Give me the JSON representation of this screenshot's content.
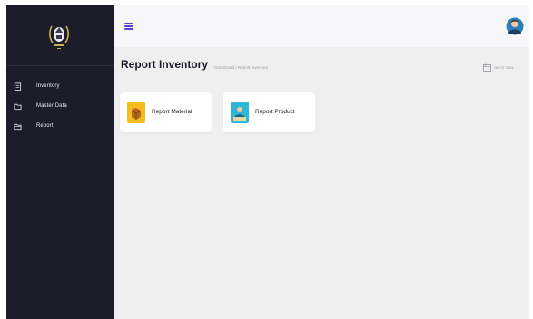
{
  "sidebar": {
    "items": [
      {
        "label": "Inventory",
        "icon": "clipboard-icon"
      },
      {
        "label": "Master Data",
        "icon": "folder-icon"
      },
      {
        "label": "Report",
        "icon": "document-icon"
      }
    ]
  },
  "header": {
    "title": "Report Inventory",
    "breadcrumb": {
      "home": "Dashboard",
      "separator": "/",
      "current": "Report Inventory"
    },
    "date": "Oct 07 2021"
  },
  "cards": [
    {
      "label": "Report Material",
      "icon": "box-icon",
      "color": "#f6be1c"
    },
    {
      "label": "Report Product",
      "icon": "product-icon",
      "color": "#2fb7d6"
    }
  ],
  "colors": {
    "sidebar_bg": "#1c1c2b",
    "accent": "#5e3fd3",
    "content_bg": "#efefef"
  }
}
